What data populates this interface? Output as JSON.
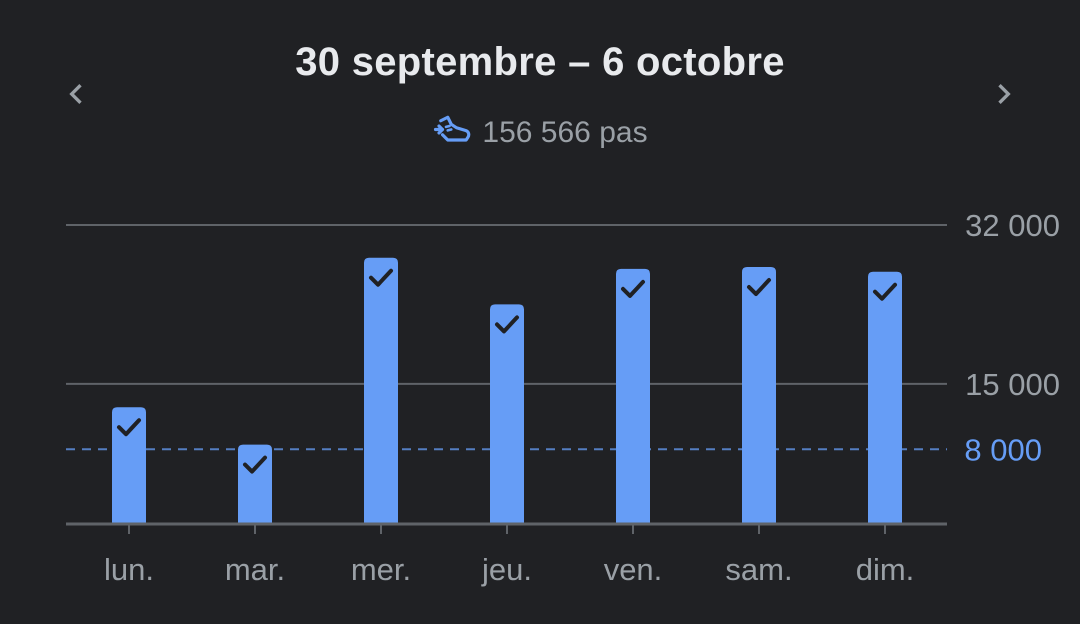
{
  "header": {
    "title": "30 septembre – 6 octobre",
    "total_steps": "156 566 pas",
    "prev_icon": "chevron-left-icon",
    "next_icon": "chevron-right-icon",
    "steps_icon": "shoe-steps-icon"
  },
  "colors": {
    "background": "#202124",
    "bar": "#669df6",
    "goal_line": "#669df6",
    "grid": "#5f6368",
    "text_primary": "#e8eaed",
    "text_secondary": "#9aa0a6",
    "check": "#202124"
  },
  "chart_data": {
    "type": "bar",
    "categories": [
      "lun.",
      "mar.",
      "mer.",
      "jeu.",
      "ven.",
      "sam.",
      "dim."
    ],
    "values": [
      12500,
      8500,
      28500,
      23500,
      27300,
      27500,
      27000
    ],
    "goal": 8000,
    "goal_label": "8 000",
    "goal_met": [
      true,
      true,
      true,
      true,
      true,
      true,
      true
    ],
    "y_ticks": [
      {
        "value": 32000,
        "label": "32 000"
      },
      {
        "value": 15000,
        "label": "15 000"
      }
    ],
    "ylim": [
      0,
      32000
    ],
    "grid": true
  }
}
